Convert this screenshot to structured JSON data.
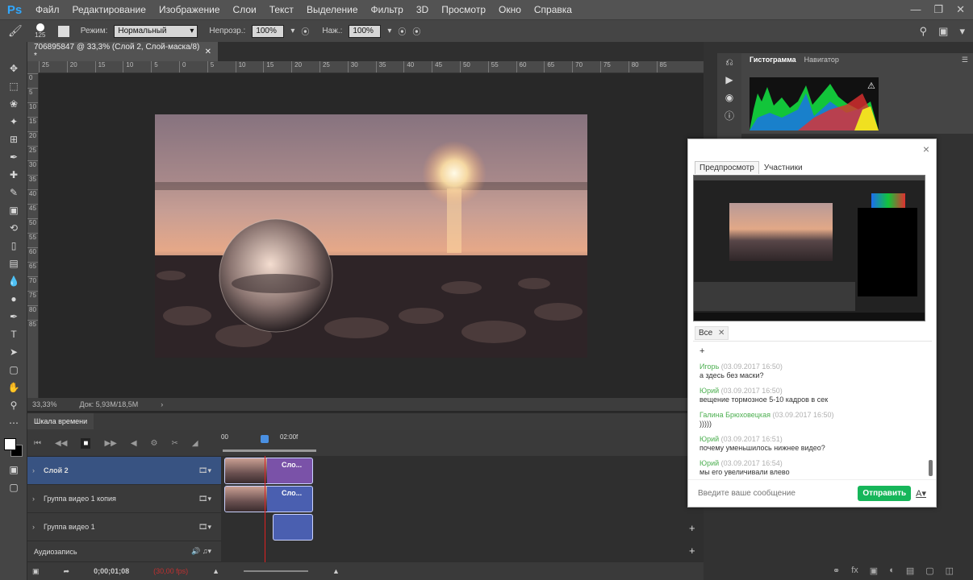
{
  "app": {
    "logo": "Ps"
  },
  "menu": [
    "Файл",
    "Редактирование",
    "Изображение",
    "Слои",
    "Текст",
    "Выделение",
    "Фильтр",
    "3D",
    "Просмотр",
    "Окно",
    "Справка"
  ],
  "options_bar": {
    "brush_size": "125",
    "mode_label": "Режим:",
    "mode_value": "Нормальный",
    "opacity_label": "Непрозр.:",
    "opacity_value": "100%",
    "flow_label": "Наж.:",
    "flow_value": "100%"
  },
  "document": {
    "tab_title": "706895847 @ 33,3% (Слой 2, Слой-маска/8) *",
    "zoom": "33,33%",
    "doc_size": "Док: 5,93M/18,5M"
  },
  "ruler_h": [
    "25",
    "20",
    "15",
    "10",
    "5",
    "0",
    "5",
    "10",
    "15",
    "20",
    "25",
    "30",
    "35",
    "40",
    "45",
    "50",
    "55",
    "60",
    "65",
    "70",
    "75",
    "80",
    "85"
  ],
  "ruler_v": [
    "0",
    "5",
    "10",
    "15",
    "20",
    "25",
    "30",
    "35",
    "40",
    "45",
    "50",
    "55",
    "60",
    "65",
    "70",
    "75",
    "80",
    "85"
  ],
  "timeline": {
    "tab": "Шкала времени",
    "time_start": "00",
    "time_mark": "02:00f",
    "tracks": [
      {
        "name": "Слой 2",
        "clip_label": "Сло..."
      },
      {
        "name": "Группа видео 1 копия",
        "clip_label": "Сло..."
      },
      {
        "name": "Группа видео 1",
        "clip_label": ""
      }
    ],
    "audio": "Аудиозапись",
    "timecode": "0;00;01;08",
    "fps": "(30,00 fps)"
  },
  "panels": {
    "histogram_tab": "Гистограмма",
    "navigator_tab": "Навигатор"
  },
  "chat": {
    "tab_preview": "Предпросмотр",
    "tab_participants": "Участники",
    "filter": "Все",
    "plus": "+",
    "messages": [
      {
        "name": "Игорь",
        "time": "(03.09.2017 16:50)",
        "text": "а здесь без маски?"
      },
      {
        "name": "Юрий",
        "time": "(03.09.2017 16:50)",
        "text": "вещение тормозное 5-10 кадров в сек"
      },
      {
        "name": "Галина Брюховецкая",
        "time": "(03.09.2017 16:50)",
        "text": ")))))"
      },
      {
        "name": "Юрий",
        "time": "(03.09.2017 16:51)",
        "text": "почему уменьшилось нижнее видео?"
      },
      {
        "name": "Юрий",
        "time": "(03.09.2017 16:54)",
        "text": "мы его увеличивали влево"
      }
    ],
    "input_placeholder": "Введите ваше сообщение",
    "send_label": "Отправить"
  }
}
